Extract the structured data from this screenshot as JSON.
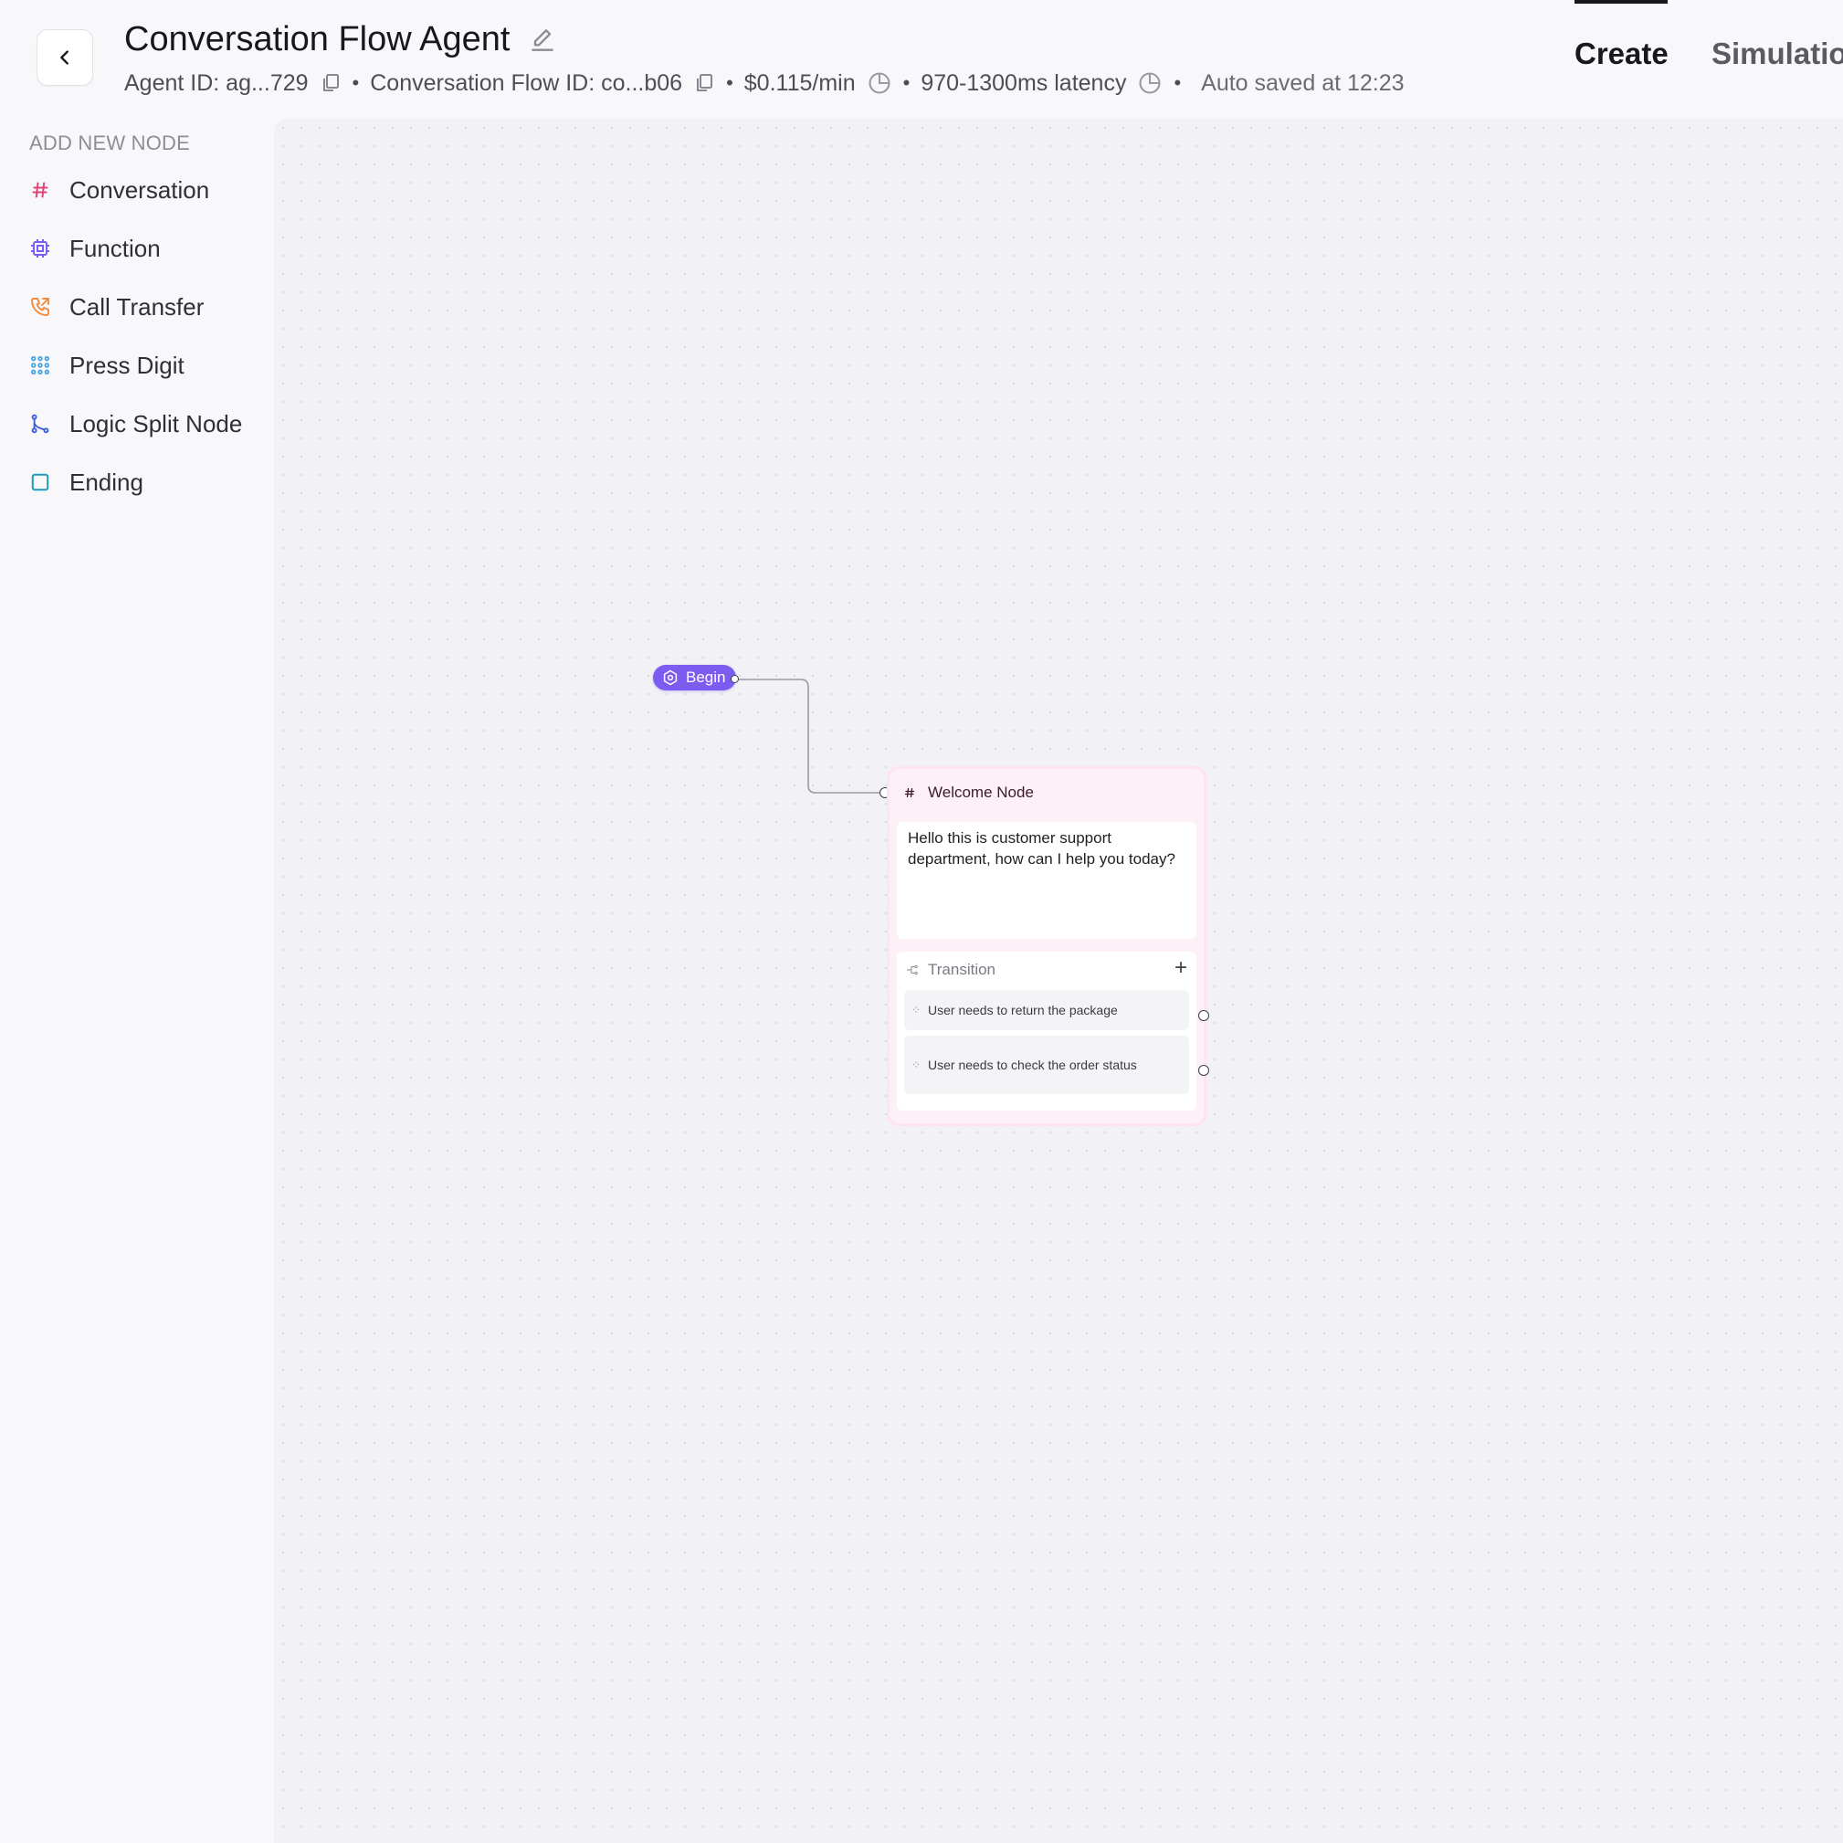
{
  "header": {
    "title": "Conversation Flow Agent",
    "agent_id": "Agent ID: ag...729",
    "flow_id": "Conversation Flow ID: co...b06",
    "cost": "$0.115/min",
    "latency": "970-1300ms latency",
    "autosave": "Auto saved at 12:23",
    "tabs": [
      "Create",
      "Simulatio"
    ]
  },
  "sidebar": {
    "heading": "ADD NEW NODE",
    "items": [
      {
        "label": "Conversation",
        "icon": "hash-icon",
        "color": "#e0457a"
      },
      {
        "label": "Function",
        "icon": "cpu-chip-icon",
        "color": "#7c5cf0"
      },
      {
        "label": "Call Transfer",
        "icon": "phone-transfer-icon",
        "color": "#f28a3c"
      },
      {
        "label": "Press Digit",
        "icon": "keypad-icon",
        "color": "#3aa0e0"
      },
      {
        "label": "Logic Split Node",
        "icon": "branch-icon",
        "color": "#3b5bdb"
      },
      {
        "label": "Ending",
        "icon": "square-icon",
        "color": "#1a9bb8"
      }
    ]
  },
  "canvas": {
    "begin": {
      "label": "Begin",
      "color": "#7c5cf0"
    },
    "welcome_node": {
      "title": "Welcome Node",
      "message": "Hello this is customer support department, how can I help you today?",
      "transition_label": "Transition",
      "conditions": [
        "User needs to return the package",
        "User needs to check the order status"
      ]
    }
  }
}
